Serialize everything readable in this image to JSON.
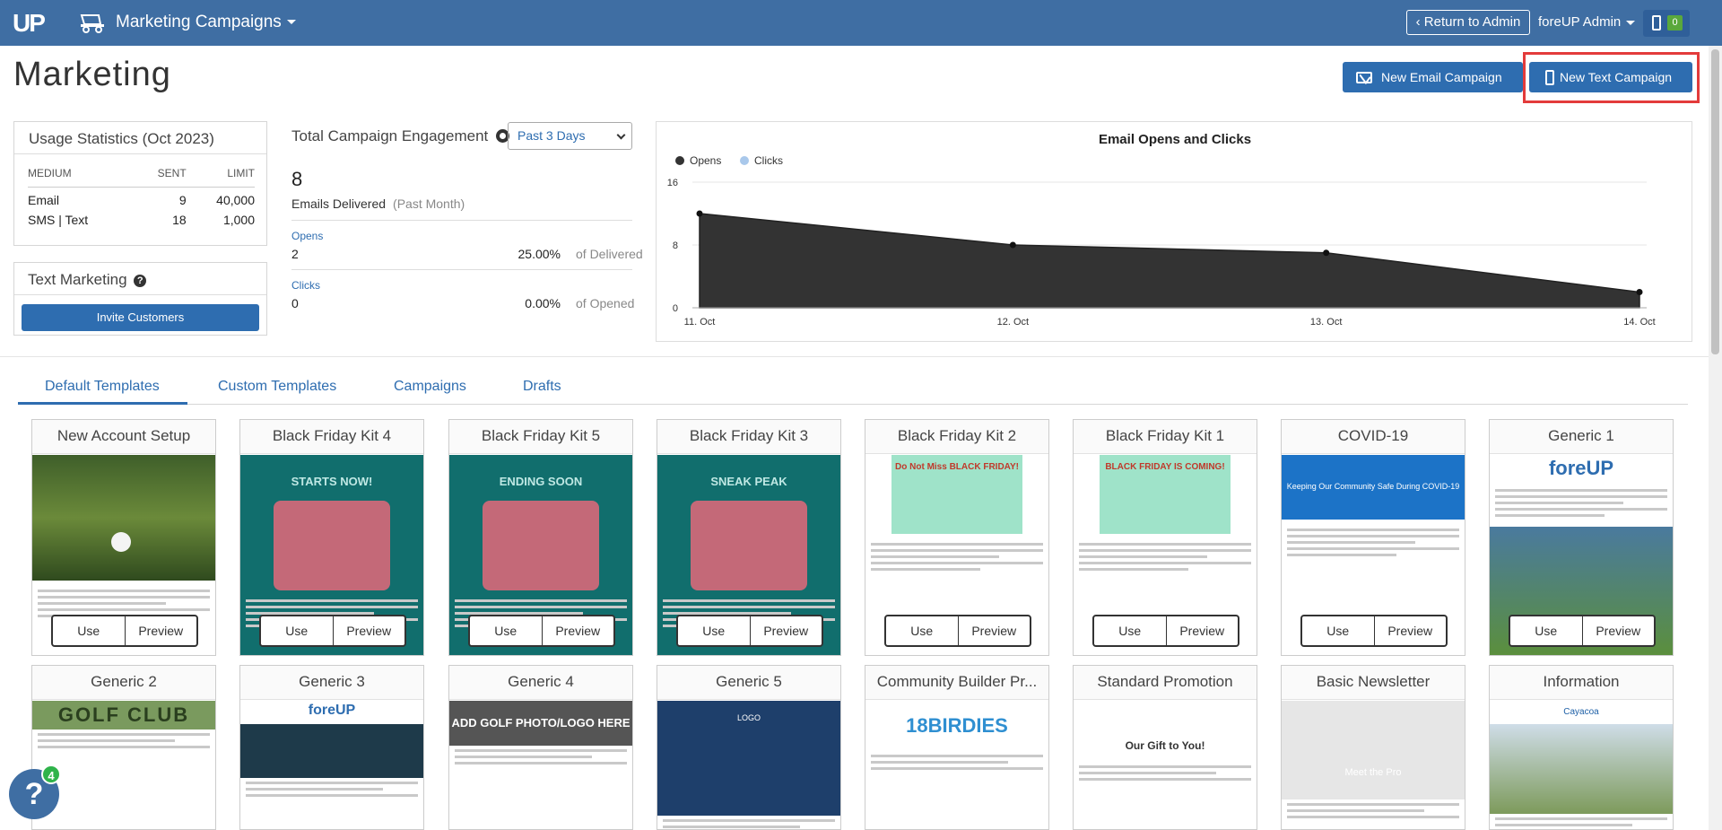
{
  "nav": {
    "logo": "UP",
    "app_title": "Marketing Campaigns",
    "return_label": "Return to Admin",
    "admin_label": "foreUP Admin",
    "device_count": "0"
  },
  "page": {
    "title": "Marketing",
    "new_email_label": "New Email Campaign",
    "new_text_label": "New Text Campaign"
  },
  "usage": {
    "title": "Usage Statistics (Oct 2023)",
    "columns": [
      "MEDIUM",
      "SENT",
      "LIMIT"
    ],
    "rows": [
      {
        "medium": "Email",
        "sent": "9",
        "limit": "40,000"
      },
      {
        "medium": "SMS | Text",
        "sent": "18",
        "limit": "1,000"
      }
    ]
  },
  "text_marketing": {
    "title": "Text Marketing",
    "help": "?",
    "invite_label": "Invite Customers"
  },
  "engagement": {
    "title": "Total Campaign Engagement",
    "range": "Past 3 Days",
    "delivered_count": "8",
    "delivered_label": "Emails Delivered",
    "delivered_period": "(Past Month)",
    "opens_label": "Opens",
    "opens_value": "2",
    "opens_pct": "25.00%",
    "opens_of": "of Delivered",
    "clicks_label": "Clicks",
    "clicks_value": "0",
    "clicks_pct": "0.00%",
    "clicks_of": "of Opened"
  },
  "chart_data": {
    "type": "area",
    "title": "Email Opens and Clicks",
    "categories": [
      "11. Oct",
      "12. Oct",
      "13. Oct",
      "14. Oct"
    ],
    "series": [
      {
        "name": "Opens",
        "values": [
          12.0,
          8.0,
          7.0,
          2.0
        ],
        "color": "#333333"
      },
      {
        "name": "Clicks",
        "values": [
          0,
          0,
          0,
          0
        ],
        "color": "#a9c8eb"
      }
    ],
    "yticks": [
      0,
      8,
      16
    ],
    "ylim": [
      0,
      16
    ],
    "legend": "top-left"
  },
  "tabs": [
    "Default Templates",
    "Custom Templates",
    "Campaigns",
    "Drafts"
  ],
  "card_actions": {
    "use": "Use",
    "preview": "Preview"
  },
  "templates_row1": [
    {
      "name": "New Account Setup",
      "style": "golf"
    },
    {
      "name": "Black Friday Kit 4",
      "style": "teal",
      "banner": "STARTS NOW!"
    },
    {
      "name": "Black Friday Kit 5",
      "style": "teal",
      "banner": "ENDING SOON"
    },
    {
      "name": "Black Friday Kit 3",
      "style": "teal",
      "banner": "SNEAK PEAK"
    },
    {
      "name": "Black Friday Kit 2",
      "style": "mint",
      "banner": "Do Not Miss BLACK FRIDAY!"
    },
    {
      "name": "Black Friday Kit 1",
      "style": "mint2",
      "banner": "BLACK FRIDAY IS COMING!"
    },
    {
      "name": "COVID-19",
      "style": "blue",
      "banner": "Keeping Our Community Safe During COVID-19"
    },
    {
      "name": "Generic 1",
      "style": "logo",
      "banner": "foreUP"
    }
  ],
  "templates_row2": [
    {
      "name": "Generic 2",
      "banner": "GOLF CLUB"
    },
    {
      "name": "Generic 3",
      "banner": "foreUP"
    },
    {
      "name": "Generic 4",
      "banner": "ADD GOLF PHOTO/LOGO HERE"
    },
    {
      "name": "Generic 5",
      "banner": "LOGO"
    },
    {
      "name": "Community Builder Pr...",
      "banner": "18BIRDIES"
    },
    {
      "name": "Standard Promotion",
      "banner": "Our Gift to You!"
    },
    {
      "name": "Basic Newsletter",
      "banner": "Meet the Pro"
    },
    {
      "name": "Information",
      "banner": "Cayacoa"
    }
  ],
  "help_badge": "4",
  "help_label": "?"
}
